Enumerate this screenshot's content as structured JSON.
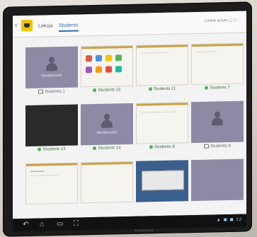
{
  "topbar": {
    "tabs": [
      {
        "label": "Lekcja"
      },
      {
        "label": "Students"
      }
    ],
    "right_text": "Lorem ipsum  ▢  ▢  ◌"
  },
  "students": [
    {
      "caption": "Students 1",
      "state": "absent",
      "status": "lock",
      "absent_label": "Nieobecność"
    },
    {
      "caption": "Students 15",
      "state": "apps",
      "status": "online"
    },
    {
      "caption": "Students 11",
      "state": "doc",
      "status": "online"
    },
    {
      "caption": "Students 7",
      "state": "doc",
      "status": "online"
    },
    {
      "caption": "Students 13",
      "state": "dark",
      "status": "online"
    },
    {
      "caption": "Students 14",
      "state": "absent",
      "status": "online",
      "absent_label": "Nieobecność"
    },
    {
      "caption": "Students 8",
      "state": "doc",
      "status": "online"
    },
    {
      "caption": "Students 8",
      "state": "absent",
      "status": "lock"
    },
    {
      "caption": "",
      "state": "doc",
      "status": "none"
    },
    {
      "caption": "",
      "state": "doc",
      "status": "none"
    },
    {
      "caption": "",
      "state": "dialog",
      "status": "none"
    },
    {
      "caption": "",
      "state": "absent",
      "status": "none"
    }
  ],
  "sysbar": {
    "nav_back": "↶",
    "nav_home": "⌂",
    "nav_recent": "▭",
    "nav_screenshot": "⛶",
    "status_text": "▲ ▣ ◼ 12"
  },
  "brand_text": "SAMSUNG",
  "colors": {
    "accent": "#2a6fb8",
    "online": "#4bb34b",
    "app_yellow": "#f2c400",
    "absent_tile": "#8e8aa6"
  }
}
